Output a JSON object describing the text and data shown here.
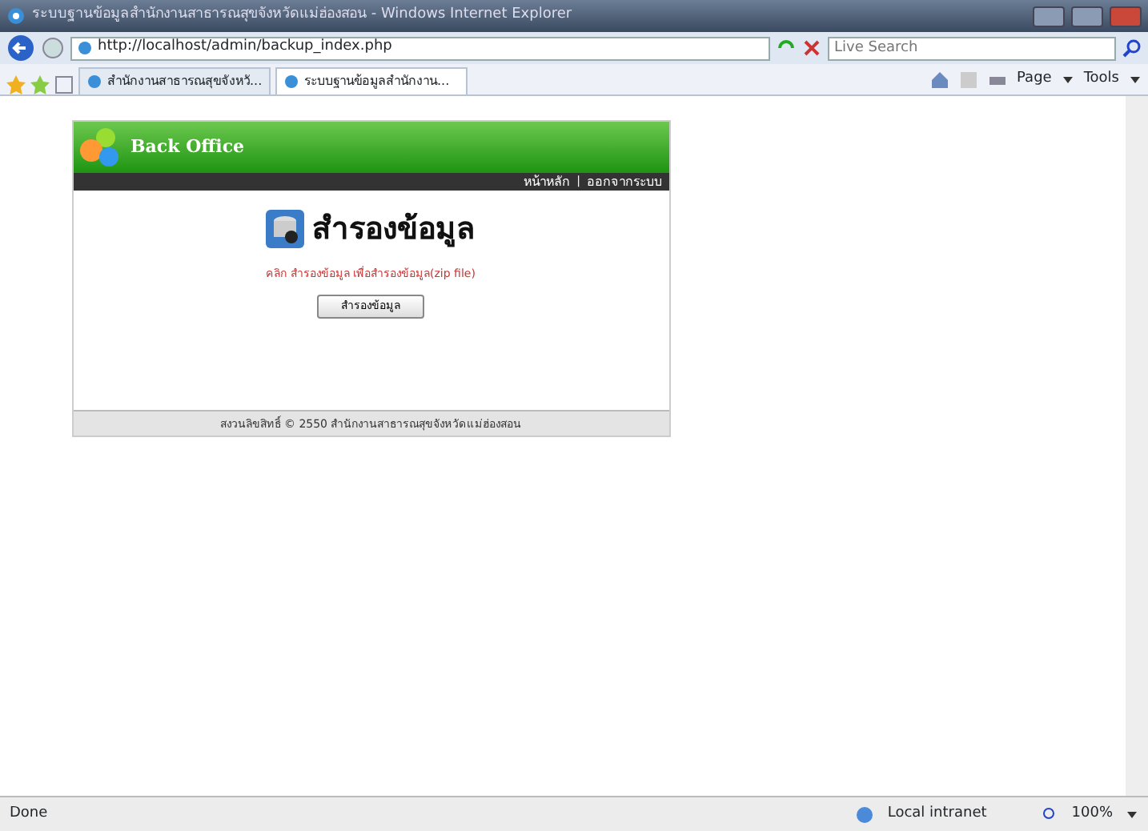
{
  "window": {
    "title": "ระบบฐานข้อมูลสำนักงานสาธารณสุขจังหวัดแม่ฮ่องสอน - Windows Internet Explorer"
  },
  "address_bar": {
    "url": "http://localhost/admin/backup_index.php",
    "search_placeholder": "Live Search"
  },
  "tabs": [
    {
      "label": "สำนักงานสาธารณสุขจังหวั...",
      "selected": false
    },
    {
      "label": "ระบบฐานข้อมูลสำนักงาน...",
      "selected": true
    }
  ],
  "command_bar": [
    "Page",
    "Tools"
  ],
  "site": {
    "logo": "Back Office",
    "links": [
      "หน้าหลัก",
      "ออกจากระบบ"
    ],
    "separator": "|",
    "heading": "สำรองข้อมูล",
    "instruction": "คลิก สำรองข้อมูล เพื่อสำรองข้อมูล(zip file)",
    "button": "สำรองข้อมูล",
    "footer": "สงวนลิขสิทธิ์ © 2550 สำนักงานสาธารณสุขจังหวัดแม่ฮ่องสอน"
  },
  "status_bar": {
    "status": "Done",
    "zone": "Local intranet",
    "zoom": "100%"
  }
}
